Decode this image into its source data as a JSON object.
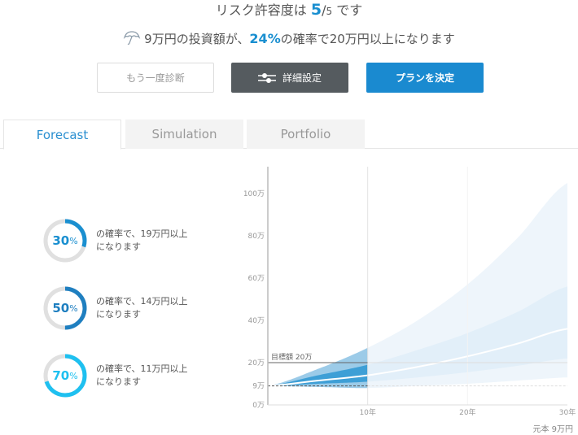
{
  "header": {
    "risk_prefix": "リスク許容度は ",
    "risk_value": "5",
    "risk_slash": "/",
    "risk_max": "5",
    "risk_suffix": " です",
    "summary_icon": "umbrella-icon",
    "summary_prefix": "9万円の投資額が、",
    "summary_pct": "24%",
    "summary_suffix": "の確率で20万円以上になります"
  },
  "buttons": {
    "retry_label": "もう一度診断",
    "settings_label": "詳細設定",
    "settings_icon": "sliders-icon",
    "plan_label": "プランを決定"
  },
  "tabs": [
    {
      "label": "Forecast",
      "active": true
    },
    {
      "label": "Simulation",
      "active": false
    },
    {
      "label": "Portfolio",
      "active": false
    }
  ],
  "probabilities": [
    {
      "value": "30",
      "percent": 30,
      "unit": "%",
      "line1": "の確率で、19万円以上",
      "line2": "になります",
      "color": "#1a8fd0"
    },
    {
      "value": "50",
      "percent": 50,
      "unit": "%",
      "line1": "の確率で、14万円以上",
      "line2": "になります",
      "color": "#1f7fc0"
    },
    {
      "value": "70",
      "percent": 70,
      "unit": "%",
      "line1": "の確率で、11万円以上",
      "line2": "になります",
      "color": "#1ec0f0"
    }
  ],
  "colors": {
    "accent": "#1a8fd0",
    "ring_track": "#e0e0e0",
    "band_outer_near": "#9ccbe8",
    "band_inner_near": "#3e9fd6",
    "band_outer_far": "#eef5fb",
    "band_inner_far": "#e2eff9"
  },
  "chart_data": {
    "type": "area",
    "title": "",
    "xlabel": "",
    "ylabel": "",
    "x_unit": "年",
    "y_unit": "万",
    "xlim": [
      0,
      30
    ],
    "ylim": [
      0,
      110
    ],
    "x_ticks": [
      10,
      20,
      30
    ],
    "x_tick_labels": [
      "10年",
      "20年",
      "30年"
    ],
    "y_ticks": [
      0,
      9,
      20,
      40,
      60,
      80,
      100
    ],
    "y_tick_labels": [
      "0万",
      "9万",
      "20万",
      "40万",
      "60万",
      "80万",
      "100万"
    ],
    "highlight_until_year": 10,
    "x": [
      0,
      5,
      10,
      15,
      20,
      25,
      30
    ],
    "series": [
      {
        "name": "outer_upper",
        "values": [
          9,
          17,
          27,
          40,
          57,
          79,
          105
        ]
      },
      {
        "name": "inner_upper",
        "values": [
          9,
          14,
          19,
          26,
          34,
          44,
          56
        ]
      },
      {
        "name": "median",
        "values": [
          9,
          11.5,
          14,
          18,
          23,
          29,
          36
        ]
      },
      {
        "name": "inner_lower",
        "values": [
          9,
          10,
          11,
          13,
          15.5,
          18.5,
          22
        ]
      },
      {
        "name": "outer_lower",
        "values": [
          9,
          8.5,
          8,
          9,
          10,
          11.5,
          13
        ]
      }
    ],
    "target": {
      "label": "目標額 20万",
      "value": 20
    },
    "principal": {
      "value": 9
    },
    "principal_caption": "元本 9万円",
    "grid": false,
    "legend": "none"
  }
}
